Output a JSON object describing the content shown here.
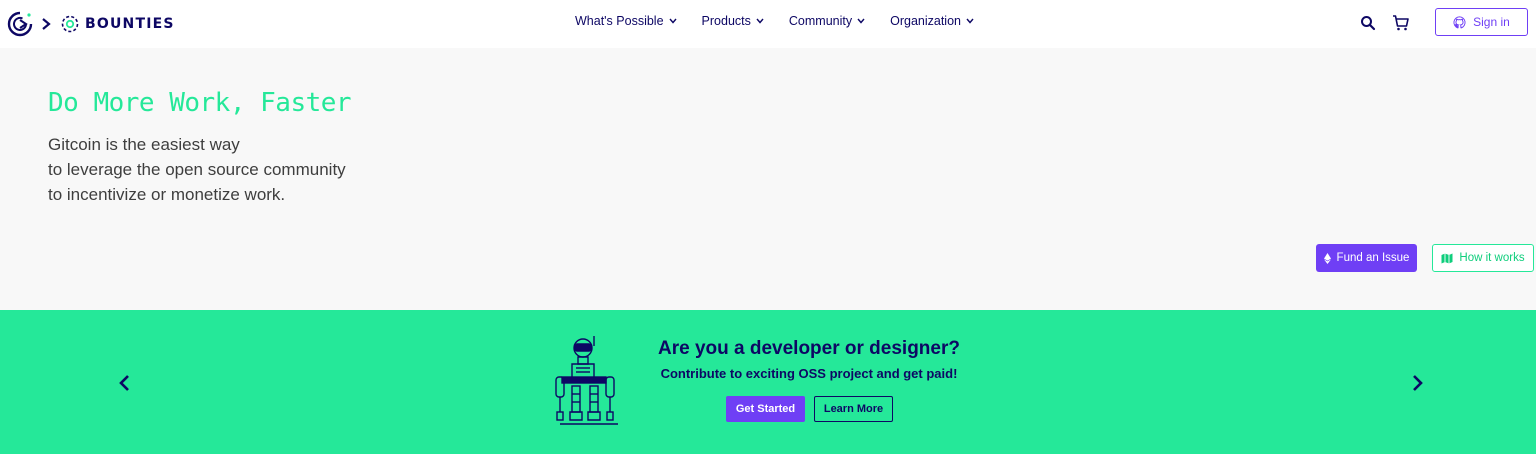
{
  "brand": {
    "name": "BOUNTIES",
    "logo_icon": "gitcoin-logo-icon",
    "separator_icon": "chevron-right-icon",
    "section_icon": "bounties-logo-icon"
  },
  "nav": {
    "items": [
      {
        "label": "What's Possible"
      },
      {
        "label": "Products"
      },
      {
        "label": "Community"
      },
      {
        "label": "Organization"
      }
    ],
    "search_icon": "search-icon",
    "cart_icon": "cart-icon",
    "signin_label": "Sign in",
    "signin_icon": "github-icon"
  },
  "hero": {
    "title": "Do More Work, Faster",
    "description_lines": [
      "Gitcoin is the easiest way",
      "to leverage the open source community",
      "to incentivize or monetize work."
    ],
    "fund_label": "Fund an Issue",
    "fund_icon": "ethereum-icon",
    "how_label": "How it works",
    "how_icon": "map-icon"
  },
  "promo": {
    "title": "Are you a developer or designer?",
    "subtitle": "Contribute to exciting OSS project and get paid!",
    "get_started_label": "Get Started",
    "learn_more_label": "Learn More",
    "illustration": "robot-illustration",
    "prev_icon": "chevron-left-icon",
    "next_icon": "chevron-right-icon"
  },
  "colors": {
    "accent_purple": "#6f3ff5",
    "accent_green": "#25e899",
    "navy": "#0d0764",
    "hero_bg": "#f8f8f8"
  }
}
